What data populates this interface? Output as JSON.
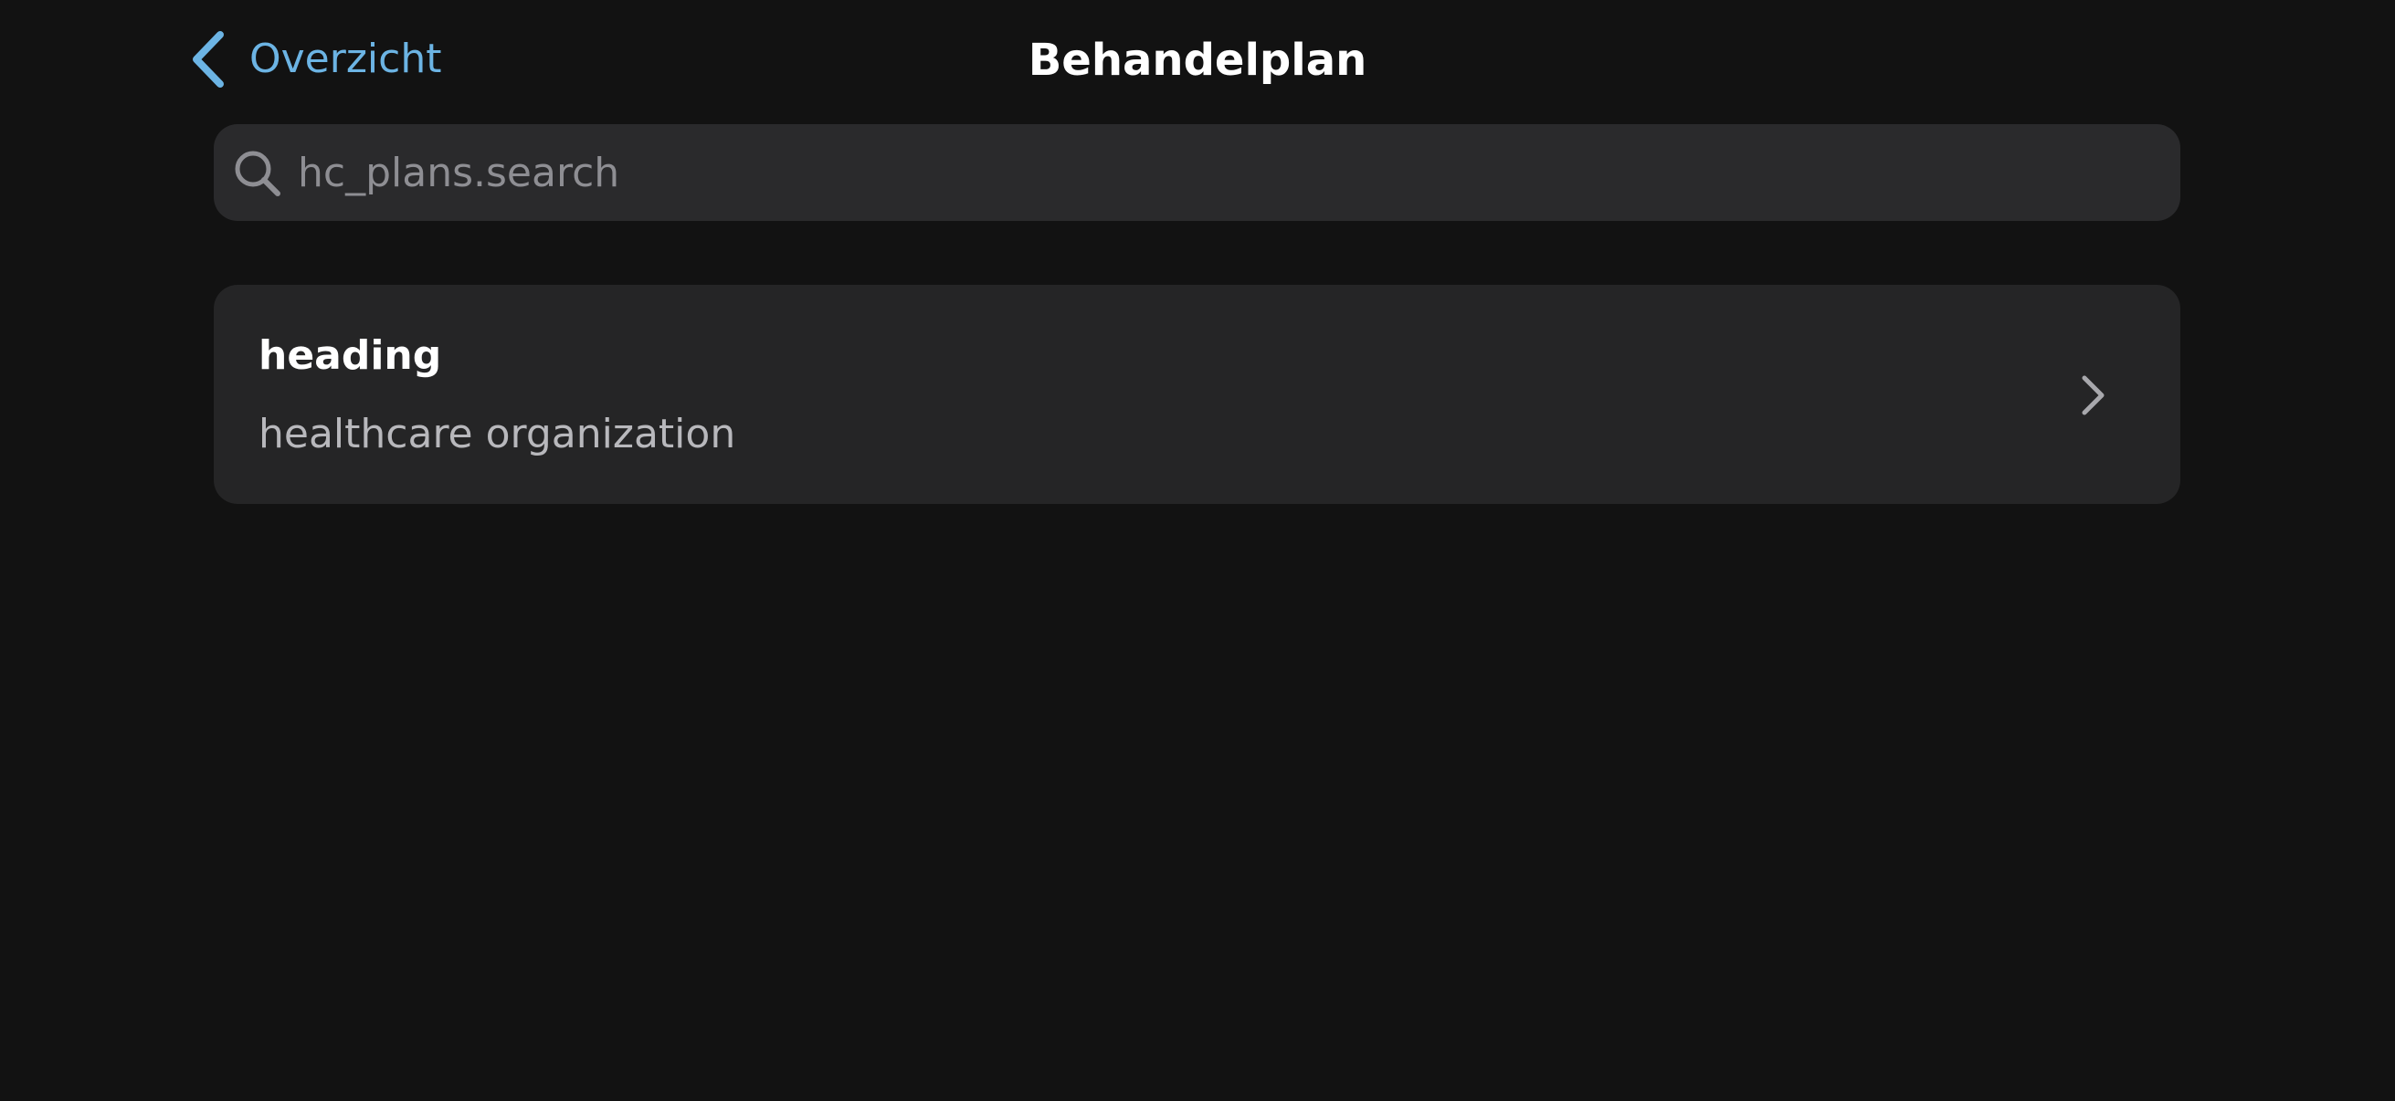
{
  "nav": {
    "back_label": "Overzicht",
    "title": "Behandelplan"
  },
  "search": {
    "placeholder": "hc_plans.search",
    "value": ""
  },
  "list": {
    "items": [
      {
        "heading": "heading",
        "subtitle": "healthcare organization"
      }
    ]
  },
  "colors": {
    "background": "#121212",
    "accent": "#6cb4e4",
    "card": "#252526",
    "search_field": "#2a2a2c"
  },
  "icons": {
    "back": "chevron-left-icon",
    "search": "search-icon",
    "disclosure": "chevron-right-icon"
  }
}
